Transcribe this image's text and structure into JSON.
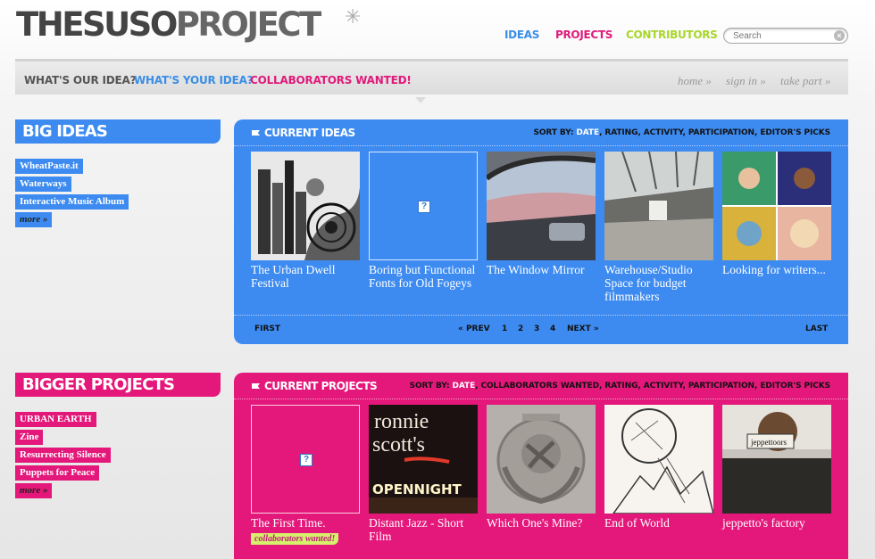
{
  "header": {
    "logo": {
      "part1": "THE",
      "part2": "SUSO",
      "part3": "PROJECT"
    },
    "nav": [
      {
        "label": "IDEAS",
        "color": "#3a8ee6"
      },
      {
        "label": "PROJECTS",
        "color": "#e01a7a"
      },
      {
        "label": "CONTRIBUTORS",
        "color": "#a8d62a"
      }
    ],
    "search": {
      "placeholder": "Search"
    }
  },
  "subnav": {
    "items": [
      {
        "label": "WHAT'S OUR IDEA?",
        "color": "#555555"
      },
      {
        "label": "WHAT'S YOUR IDEA?",
        "color": "#3a8ee6"
      },
      {
        "label": "COLLABORATORS WANTED!",
        "color": "#e01a7a"
      }
    ],
    "util": [
      "home »",
      "sign in »",
      "take part »"
    ]
  },
  "colors": {
    "blue": "#3d8bf0",
    "pink": "#e4177a"
  },
  "ideas": {
    "section_title": "BIG IDEAS",
    "side_items": [
      "WheatPaste.it",
      "Waterways",
      "Interactive Music Album"
    ],
    "more_label": "more »",
    "panel_title": "CURRENT IDEAS",
    "sort_label": "SORT BY:",
    "sort_options": [
      "DATE",
      "RATING",
      "ACTIVITY",
      "PARTICIPATION",
      "EDITOR'S PICKS"
    ],
    "items": [
      {
        "title": "The Urban Dwell Festival",
        "thumb": "city-illustration"
      },
      {
        "title": "Boring but Functional Fonts for Old Fogeys",
        "thumb": "missing-image"
      },
      {
        "title": "The Window Mirror",
        "thumb": "car-window"
      },
      {
        "title": "Warehouse/Studio Space for budget filmmakers",
        "thumb": "warehouse"
      },
      {
        "title": "Looking for writers...",
        "thumb": "album-covers"
      }
    ],
    "pager": {
      "first": "FIRST",
      "prev": "« PREV",
      "pages": [
        "1",
        "2",
        "3",
        "4"
      ],
      "next": "NEXT »",
      "last": "LAST"
    }
  },
  "projects": {
    "section_title": "BIGGER PROJECTS",
    "side_items": [
      "URBAN EARTH",
      "Zine",
      "Resurrecting Silence",
      "Puppets for Peace"
    ],
    "more_label": "more »",
    "panel_title": "CURRENT PROJECTS",
    "sort_label": "SORT BY:",
    "sort_options": [
      "DATE",
      "COLLABORATORS WANTED",
      "RATING",
      "ACTIVITY",
      "PARTICIPATION",
      "EDITOR'S PICKS"
    ],
    "items": [
      {
        "title": "The First Time.",
        "thumb": "missing-image",
        "badge": "collaborators wanted!"
      },
      {
        "title": "Distant Jazz - Short Film",
        "thumb": "neon-sign"
      },
      {
        "title": "Which One's Mine?",
        "thumb": "soviet-emblem"
      },
      {
        "title": "End of World",
        "thumb": "sketch"
      },
      {
        "title": "jeppetto's factory",
        "thumb": "jeppetto-sign"
      }
    ],
    "neon_text": [
      "ronnie",
      "scott's",
      "OPENNIGHT"
    ],
    "jeppetto_sign": "jeppettoors"
  }
}
